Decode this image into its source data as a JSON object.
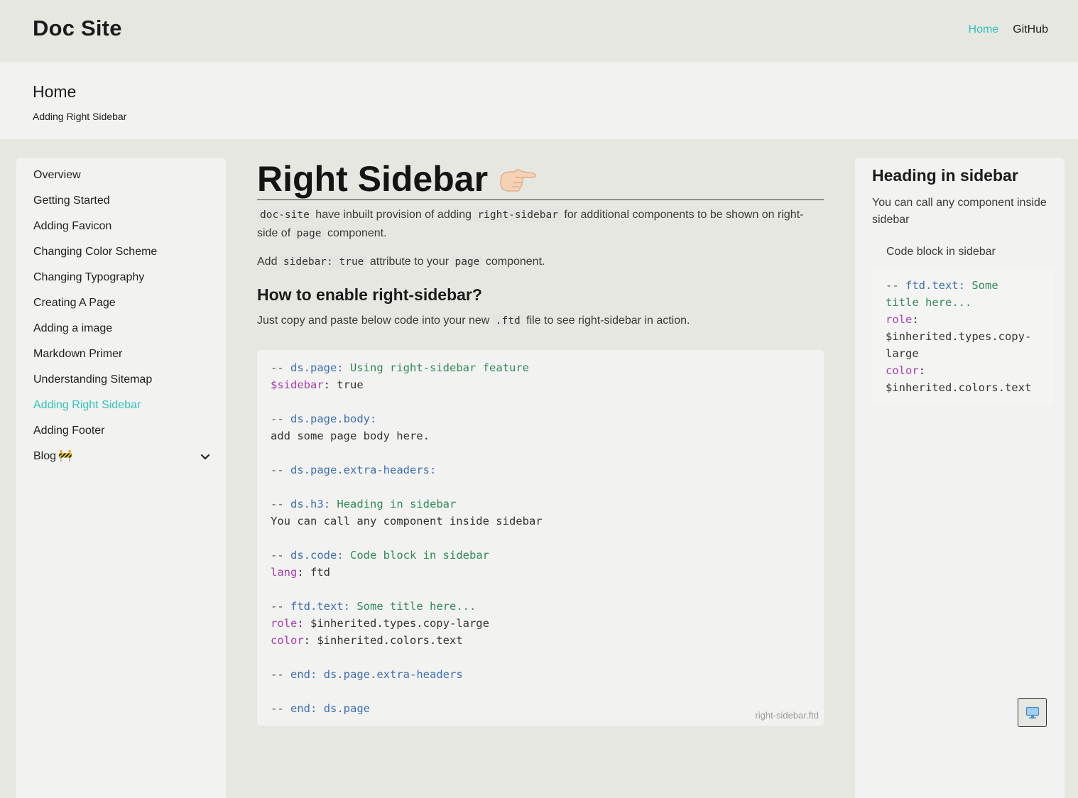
{
  "header": {
    "site_title": "Doc Site",
    "nav": [
      {
        "label": "Home",
        "active": true
      },
      {
        "label": "GitHub",
        "active": false
      }
    ]
  },
  "breadcrumb": {
    "title": "Home",
    "subtitle": "Adding Right Sidebar"
  },
  "sidebar": {
    "items": [
      {
        "label": "Overview"
      },
      {
        "label": "Getting Started"
      },
      {
        "label": "Adding Favicon"
      },
      {
        "label": "Changing Color Scheme"
      },
      {
        "label": "Changing Typography"
      },
      {
        "label": "Creating A Page"
      },
      {
        "label": "Adding a image"
      },
      {
        "label": "Markdown Primer"
      },
      {
        "label": "Understanding Sitemap"
      },
      {
        "label": "Adding Right Sidebar",
        "active": true
      },
      {
        "label": "Adding Footer"
      },
      {
        "label": "Blog",
        "emoji": "🚧",
        "expandable": true
      }
    ]
  },
  "main": {
    "title": "Right Sidebar",
    "title_icon": "pointing-hand-icon",
    "p1": {
      "c1": "doc-site",
      "t1": " have inbuilt provision of adding ",
      "c2": "right-sidebar",
      "t2": " for additional components to be shown on right-side of ",
      "c3": "page",
      "t3": " component."
    },
    "p2": {
      "t1": "Add ",
      "c1": "sidebar: true",
      "t2": " attribute to your ",
      "c2": "page",
      "t3": " component."
    },
    "h2": "How to enable right-sidebar?",
    "p3": {
      "t1": "Just copy and paste below code into your new ",
      "c1": ".ftd",
      "t2": " file to see right-sidebar in action."
    },
    "code": {
      "lines": [
        "-- ds.page: Using right-sidebar feature",
        "$sidebar: true",
        "",
        "-- ds.page.body:",
        "add some page body here.",
        "",
        "-- ds.page.extra-headers:",
        "",
        "-- ds.h3: Heading in sidebar",
        "You can call any component inside sidebar",
        "",
        "-- ds.code: Code block in sidebar",
        "lang: ftd",
        "",
        "-- ftd.text: Some title here...",
        "role: $inherited.types.copy-large",
        "color: $inherited.colors.text",
        "",
        "-- end: ds.page.extra-headers",
        "",
        "-- end: ds.page"
      ],
      "filename": "right-sidebar.ftd"
    }
  },
  "right_sidebar": {
    "heading": "Heading in sidebar",
    "text": "You can call any component inside sidebar",
    "code_caption": "Code block in sidebar",
    "code_lines": [
      "-- ftd.text: Some",
      "title here...",
      "role:",
      "$inherited.types.copy-",
      "large",
      "color:",
      "$inherited.colors.text"
    ]
  },
  "device_toggle": {
    "icon": "desktop-monitor-icon"
  },
  "colors": {
    "accent": "#2fc4b8",
    "background": "#e7e7e2",
    "panel": "#f2f2f0",
    "code_keyword": "#3d6fb5",
    "code_string": "#2f8a5a",
    "code_key": "#a73fb4"
  }
}
